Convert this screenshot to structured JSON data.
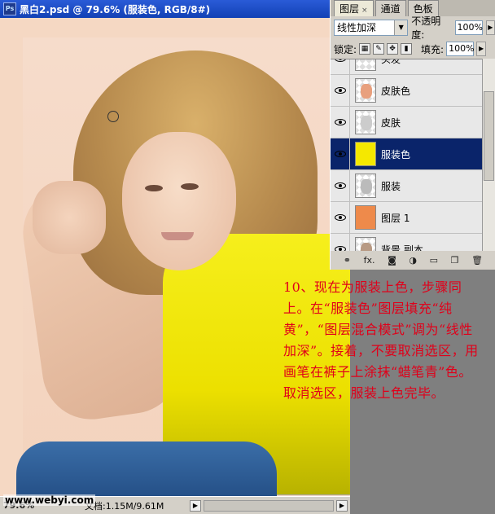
{
  "document": {
    "title": "黑白2.psd @ 79.6% (服装色, RGB/8#)",
    "app_icon": "photoshop-icon",
    "zoom": "79.6%",
    "doc_size": "文档:1.15M/9.61M",
    "watermark": "www.webyi.com"
  },
  "panel": {
    "tabs": [
      {
        "label": "图层",
        "active": true,
        "close": "×"
      },
      {
        "label": "通道",
        "active": false
      },
      {
        "label": "色板",
        "active": false
      }
    ],
    "blend_mode": "线性加深",
    "opacity_label": "不透明度:",
    "opacity_value": "100%",
    "lock_label": "锁定:",
    "fill_label": "填充:",
    "fill_value": "100%",
    "layers": [
      {
        "name": "头发",
        "visible": true,
        "thumb": "transparent"
      },
      {
        "name": "皮肤色",
        "visible": true,
        "thumb": "skin-color"
      },
      {
        "name": "皮肤",
        "visible": true,
        "thumb": "skin-mask"
      },
      {
        "name": "服装色",
        "visible": true,
        "thumb": "yellow-fill",
        "selected": true
      },
      {
        "name": "服装",
        "visible": true,
        "thumb": "clothing-mask"
      },
      {
        "name": "图层 1",
        "visible": true,
        "thumb": "orange-fill"
      },
      {
        "name": "背景 副本",
        "visible": true,
        "thumb": "photo"
      }
    ],
    "bottom_icons": [
      "link-icon",
      "fx-icon",
      "mask-icon",
      "adjustment-icon",
      "group-folder-icon",
      "new-layer-icon",
      "trash-icon"
    ],
    "fx_label": "fx."
  },
  "instruction": {
    "text": "10、现在为服装上色，步骤同上。在“服装色”图层填充“纯黄”，“图层混合模式”调为“线性加深”。接着，不要取消选区，用画笔在裤子上涂抹“蜡笔青”色。取消选区，服装上色完毕。"
  },
  "colors": {
    "title_bar": "#1241b5",
    "selected_layer": "#0a246a",
    "instruction_text": "#e0001a",
    "shirt_yellow": "#ece000",
    "canvas_bg": "#f5d8c3"
  }
}
